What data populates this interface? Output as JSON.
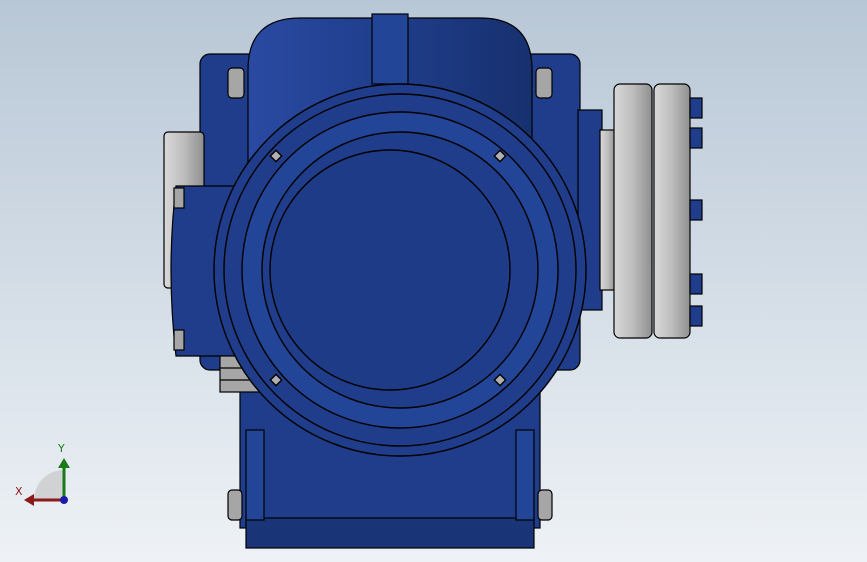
{
  "viewport": {
    "background_top": "#b8c7d6",
    "background_bottom": "#eef2f6"
  },
  "model": {
    "body_color": "#1f3d8a",
    "body_shade": "#1a3478",
    "outline_color": "#000000",
    "metal_color": "#b8b8b8",
    "metal_dark": "#8c8c8c"
  },
  "triad": {
    "x_label": "X",
    "y_label": "Y",
    "x_color": "#8b1a1a",
    "y_color": "#1a7a1a",
    "z_color": "#1a1aa8"
  }
}
